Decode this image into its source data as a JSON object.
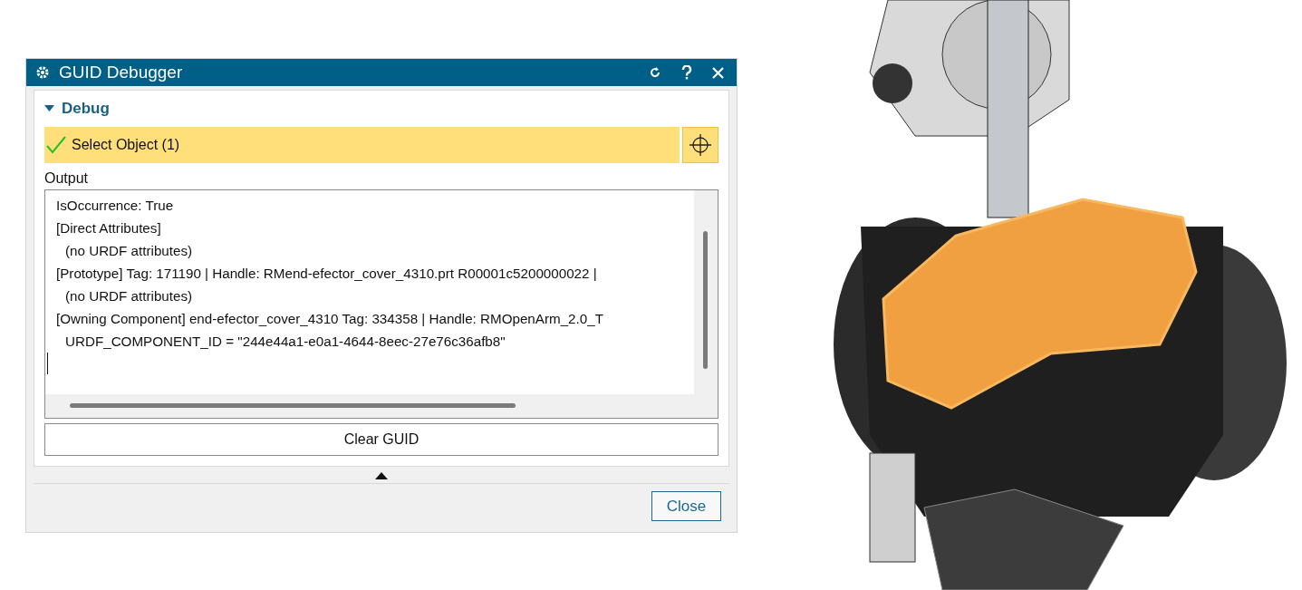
{
  "window": {
    "title": "GUID Debugger"
  },
  "section": {
    "title": "Debug",
    "expanded": true
  },
  "selection": {
    "label": "Select Object (1)",
    "checked": true
  },
  "output": {
    "label": "Output",
    "lines": [
      {
        "text": "IsOccurrence: True",
        "indented": false
      },
      {
        "text": "[Direct Attributes]",
        "indented": false
      },
      {
        "text": "(no URDF attributes)",
        "indented": true
      },
      {
        "text": "[Prototype] Tag: 171190 | Handle: RMend-efector_cover_4310.prt R00001c5200000022 |",
        "indented": false
      },
      {
        "text": "(no URDF attributes)",
        "indented": true
      },
      {
        "text": "[Owning Component] end-efector_cover_4310 Tag: 334358 | Handle: RMOpenArm_2.0_T",
        "indented": false
      },
      {
        "text": "URDF_COMPONENT_ID = \"244e44a1-e0a1-4644-8eec-27e76c36afb8\"",
        "indented": true
      }
    ]
  },
  "buttons": {
    "clear": "Clear GUID",
    "close": "Close"
  }
}
